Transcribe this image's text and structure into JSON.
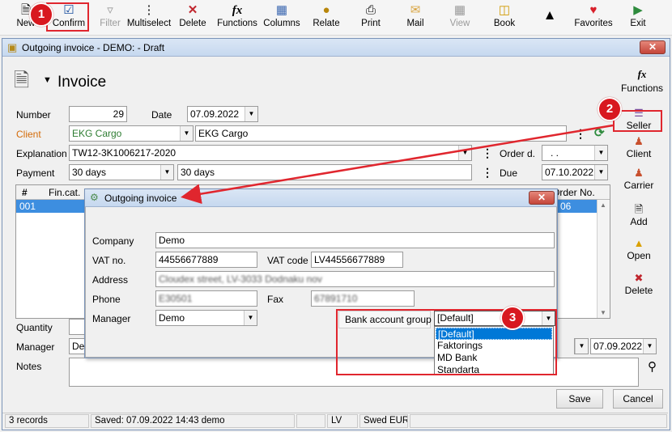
{
  "toolbar": {
    "items": [
      {
        "label": "New",
        "icon": "new-document-icon"
      },
      {
        "label": "Confirm",
        "icon": "confirm-check-icon"
      },
      {
        "label": "Filter",
        "icon": "filter-icon"
      },
      {
        "label": "Multiselect",
        "icon": "multiselect-icon"
      },
      {
        "label": "Delete",
        "icon": "delete-x-icon"
      },
      {
        "label": "Functions",
        "icon": "functions-fx-icon"
      },
      {
        "label": "Columns",
        "icon": "columns-icon"
      },
      {
        "label": "Relate",
        "icon": "relate-icon"
      },
      {
        "label": "Print",
        "icon": "printer-icon"
      },
      {
        "label": "Mail",
        "icon": "mail-icon"
      },
      {
        "label": "View",
        "icon": "view-icon"
      },
      {
        "label": "Book",
        "icon": "book-icon"
      },
      {
        "label": "",
        "icon": "bell-icon"
      },
      {
        "label": "Favorites",
        "icon": "heart-icon"
      },
      {
        "label": "Exit",
        "icon": "exit-icon"
      }
    ]
  },
  "window": {
    "title": "Outgoing invoice - DEMO:  - Draft",
    "heading": "Invoice",
    "functions_label": "Functions"
  },
  "form": {
    "number_label": "Number",
    "number_value": "29",
    "date_label": "Date",
    "date_value": "07.09.2022",
    "client_label": "Client",
    "client_code": "EKG Cargo",
    "client_name": "EKG Cargo",
    "explanation_label": "Explanation",
    "explanation_value": "TW12-3K1006217-2020",
    "order_label": "Order d.",
    "order_value": ". .",
    "payment_label": "Payment",
    "payment_value": "30 days",
    "payment_text": "30 days",
    "due_label": "Due",
    "due_value": "07.10.2022",
    "quantity_label": "Quantity",
    "manager_label": "Manager",
    "manager_value": "De",
    "manager_date": "07.09.2022",
    "notes_label": "Notes",
    "colors": {
      "client_label": "#d46b08",
      "client_green": "#2e7d32"
    }
  },
  "grid": {
    "columns": [
      "#",
      "Fin.cat.",
      "Order No."
    ],
    "rows": [
      {
        "num": "001",
        "order": "06"
      }
    ]
  },
  "sidebar": {
    "seller": "Seller",
    "client": "Client",
    "carrier": "Carrier",
    "add": "Add",
    "open": "Open",
    "delete": "Delete"
  },
  "buttons": {
    "save": "Save",
    "cancel": "Cancel"
  },
  "status": {
    "records": "3 records",
    "saved": "Saved: 07.09.2022 14:43 demo",
    "lang": "LV",
    "currency": "Swed EUR"
  },
  "dialog": {
    "title": "Outgoing invoice",
    "company_label": "Company",
    "company_value": "Demo",
    "vat_no_label": "VAT no.",
    "vat_no_value": "44556677889",
    "vat_code_label": "VAT code",
    "vat_code_value": "LV44556677889",
    "address_label": "Address",
    "address_value": "Cloudex street, LV-3033 Dodnaku nov",
    "phone_label": "Phone",
    "phone_value": "E30501",
    "fax_label": "Fax",
    "fax_value": "67891710",
    "manager_label": "Manager",
    "manager_value": "Demo",
    "bank_group_label": "Bank account group",
    "bank_group_value": "[Default]",
    "bank_group_options": [
      "[Default]",
      "Faktorings",
      "MD Bank",
      "Standarta"
    ]
  },
  "annotations": {
    "step1": "1",
    "step2": "2",
    "step3": "3",
    "color": "#e0262e"
  }
}
